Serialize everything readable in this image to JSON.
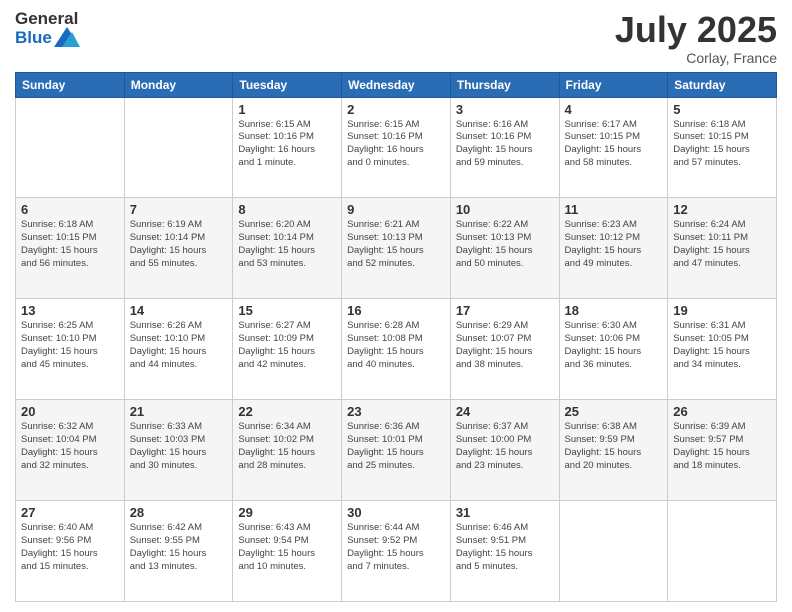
{
  "header": {
    "logo_general": "General",
    "logo_blue": "Blue",
    "title": "July 2025",
    "location": "Corlay, France"
  },
  "weekdays": [
    "Sunday",
    "Monday",
    "Tuesday",
    "Wednesday",
    "Thursday",
    "Friday",
    "Saturday"
  ],
  "weeks": [
    [
      {
        "day": "",
        "info": ""
      },
      {
        "day": "",
        "info": ""
      },
      {
        "day": "1",
        "info": "Sunrise: 6:15 AM\nSunset: 10:16 PM\nDaylight: 16 hours\nand 1 minute."
      },
      {
        "day": "2",
        "info": "Sunrise: 6:15 AM\nSunset: 10:16 PM\nDaylight: 16 hours\nand 0 minutes."
      },
      {
        "day": "3",
        "info": "Sunrise: 6:16 AM\nSunset: 10:16 PM\nDaylight: 15 hours\nand 59 minutes."
      },
      {
        "day": "4",
        "info": "Sunrise: 6:17 AM\nSunset: 10:15 PM\nDaylight: 15 hours\nand 58 minutes."
      },
      {
        "day": "5",
        "info": "Sunrise: 6:18 AM\nSunset: 10:15 PM\nDaylight: 15 hours\nand 57 minutes."
      }
    ],
    [
      {
        "day": "6",
        "info": "Sunrise: 6:18 AM\nSunset: 10:15 PM\nDaylight: 15 hours\nand 56 minutes."
      },
      {
        "day": "7",
        "info": "Sunrise: 6:19 AM\nSunset: 10:14 PM\nDaylight: 15 hours\nand 55 minutes."
      },
      {
        "day": "8",
        "info": "Sunrise: 6:20 AM\nSunset: 10:14 PM\nDaylight: 15 hours\nand 53 minutes."
      },
      {
        "day": "9",
        "info": "Sunrise: 6:21 AM\nSunset: 10:13 PM\nDaylight: 15 hours\nand 52 minutes."
      },
      {
        "day": "10",
        "info": "Sunrise: 6:22 AM\nSunset: 10:13 PM\nDaylight: 15 hours\nand 50 minutes."
      },
      {
        "day": "11",
        "info": "Sunrise: 6:23 AM\nSunset: 10:12 PM\nDaylight: 15 hours\nand 49 minutes."
      },
      {
        "day": "12",
        "info": "Sunrise: 6:24 AM\nSunset: 10:11 PM\nDaylight: 15 hours\nand 47 minutes."
      }
    ],
    [
      {
        "day": "13",
        "info": "Sunrise: 6:25 AM\nSunset: 10:10 PM\nDaylight: 15 hours\nand 45 minutes."
      },
      {
        "day": "14",
        "info": "Sunrise: 6:26 AM\nSunset: 10:10 PM\nDaylight: 15 hours\nand 44 minutes."
      },
      {
        "day": "15",
        "info": "Sunrise: 6:27 AM\nSunset: 10:09 PM\nDaylight: 15 hours\nand 42 minutes."
      },
      {
        "day": "16",
        "info": "Sunrise: 6:28 AM\nSunset: 10:08 PM\nDaylight: 15 hours\nand 40 minutes."
      },
      {
        "day": "17",
        "info": "Sunrise: 6:29 AM\nSunset: 10:07 PM\nDaylight: 15 hours\nand 38 minutes."
      },
      {
        "day": "18",
        "info": "Sunrise: 6:30 AM\nSunset: 10:06 PM\nDaylight: 15 hours\nand 36 minutes."
      },
      {
        "day": "19",
        "info": "Sunrise: 6:31 AM\nSunset: 10:05 PM\nDaylight: 15 hours\nand 34 minutes."
      }
    ],
    [
      {
        "day": "20",
        "info": "Sunrise: 6:32 AM\nSunset: 10:04 PM\nDaylight: 15 hours\nand 32 minutes."
      },
      {
        "day": "21",
        "info": "Sunrise: 6:33 AM\nSunset: 10:03 PM\nDaylight: 15 hours\nand 30 minutes."
      },
      {
        "day": "22",
        "info": "Sunrise: 6:34 AM\nSunset: 10:02 PM\nDaylight: 15 hours\nand 28 minutes."
      },
      {
        "day": "23",
        "info": "Sunrise: 6:36 AM\nSunset: 10:01 PM\nDaylight: 15 hours\nand 25 minutes."
      },
      {
        "day": "24",
        "info": "Sunrise: 6:37 AM\nSunset: 10:00 PM\nDaylight: 15 hours\nand 23 minutes."
      },
      {
        "day": "25",
        "info": "Sunrise: 6:38 AM\nSunset: 9:59 PM\nDaylight: 15 hours\nand 20 minutes."
      },
      {
        "day": "26",
        "info": "Sunrise: 6:39 AM\nSunset: 9:57 PM\nDaylight: 15 hours\nand 18 minutes."
      }
    ],
    [
      {
        "day": "27",
        "info": "Sunrise: 6:40 AM\nSunset: 9:56 PM\nDaylight: 15 hours\nand 15 minutes."
      },
      {
        "day": "28",
        "info": "Sunrise: 6:42 AM\nSunset: 9:55 PM\nDaylight: 15 hours\nand 13 minutes."
      },
      {
        "day": "29",
        "info": "Sunrise: 6:43 AM\nSunset: 9:54 PM\nDaylight: 15 hours\nand 10 minutes."
      },
      {
        "day": "30",
        "info": "Sunrise: 6:44 AM\nSunset: 9:52 PM\nDaylight: 15 hours\nand 7 minutes."
      },
      {
        "day": "31",
        "info": "Sunrise: 6:46 AM\nSunset: 9:51 PM\nDaylight: 15 hours\nand 5 minutes."
      },
      {
        "day": "",
        "info": ""
      },
      {
        "day": "",
        "info": ""
      }
    ]
  ]
}
